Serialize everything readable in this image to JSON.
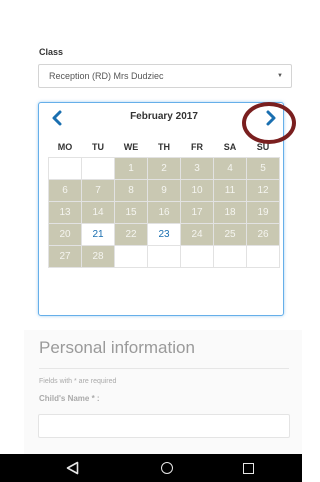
{
  "form": {
    "class_label": "Class",
    "class_value": "Reception (RD) Mrs Dudziec",
    "select_arrow": "▼"
  },
  "calendar": {
    "title": "February 2017",
    "prev_icon": "chevron-left",
    "next_icon": "chevron-right",
    "weekdays": [
      "MO",
      "TU",
      "WE",
      "TH",
      "FR",
      "SA",
      "SU"
    ],
    "weeks": [
      [
        {
          "d": "",
          "s": "empty"
        },
        {
          "d": "",
          "s": "empty"
        },
        {
          "d": "1",
          "s": "disabled"
        },
        {
          "d": "2",
          "s": "disabled"
        },
        {
          "d": "3",
          "s": "disabled"
        },
        {
          "d": "4",
          "s": "disabled"
        },
        {
          "d": "5",
          "s": "disabled"
        }
      ],
      [
        {
          "d": "6",
          "s": "disabled"
        },
        {
          "d": "7",
          "s": "disabled"
        },
        {
          "d": "8",
          "s": "disabled"
        },
        {
          "d": "9",
          "s": "disabled"
        },
        {
          "d": "10",
          "s": "disabled"
        },
        {
          "d": "11",
          "s": "disabled"
        },
        {
          "d": "12",
          "s": "disabled"
        }
      ],
      [
        {
          "d": "13",
          "s": "disabled"
        },
        {
          "d": "14",
          "s": "disabled"
        },
        {
          "d": "15",
          "s": "disabled"
        },
        {
          "d": "16",
          "s": "disabled"
        },
        {
          "d": "17",
          "s": "disabled"
        },
        {
          "d": "18",
          "s": "disabled"
        },
        {
          "d": "19",
          "s": "disabled"
        }
      ],
      [
        {
          "d": "20",
          "s": "disabled"
        },
        {
          "d": "21",
          "s": "avail"
        },
        {
          "d": "22",
          "s": "disabled"
        },
        {
          "d": "23",
          "s": "avail"
        },
        {
          "d": "24",
          "s": "disabled"
        },
        {
          "d": "25",
          "s": "disabled"
        },
        {
          "d": "26",
          "s": "disabled"
        }
      ],
      [
        {
          "d": "27",
          "s": "disabled"
        },
        {
          "d": "28",
          "s": "disabled"
        },
        {
          "d": "",
          "s": "empty"
        },
        {
          "d": "",
          "s": "empty"
        },
        {
          "d": "",
          "s": "empty"
        },
        {
          "d": "",
          "s": "empty"
        },
        {
          "d": "",
          "s": "empty"
        }
      ]
    ]
  },
  "personal": {
    "title": "Personal information",
    "required_note": "Fields with * are required",
    "child_name_label": "Child's Name * :",
    "child_name_value": ""
  },
  "colors": {
    "accent": "#1a6fb0",
    "disabled_day": "#c9c8b2",
    "annotation_circle": "#7a1f1f"
  },
  "navbar": {
    "back_icon": "back-triangle",
    "home_icon": "home-circle",
    "recent_icon": "recent-square"
  }
}
